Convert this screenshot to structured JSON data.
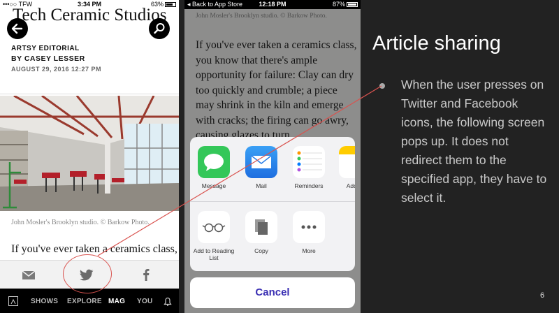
{
  "phone1": {
    "status": {
      "carrier": "•••○○ TFW",
      "time": "3:34 PM",
      "battery": "63%",
      "battery_level": 0.63
    },
    "title": "Tech Ceramic Studios",
    "editorial_label": "ARTSY EDITORIAL",
    "author": "BY CASEY LESSER",
    "date": "AUGUST 29, 2016 12:27 PM",
    "photo_caption": "John Mosler's Brooklyn studio. © Barkow Photo.",
    "body_start": "If you've ever taken a ceramics class,",
    "tabbar": {
      "shows": "SHOWS",
      "explore": "EXPLORE",
      "mag": "MAG",
      "you": "YOU"
    }
  },
  "phone2": {
    "status": {
      "back": "◂ Back to App Store",
      "time": "12:18 PM",
      "battery": "87%",
      "battery_level": 0.87
    },
    "caption": "John Mosler's Brooklyn studio. © Barkow Photo.",
    "body": "If you've ever taken a ceramics class, you know that there's ample opportunity for failure: Clay can dry too quickly and crumble; a piece may shrink in the kiln and emerge with cracks; the firing can go awry, causing glazes to turn",
    "share_apps": {
      "message": "Message",
      "mail": "Mail",
      "reminders": "Reminders",
      "addto": "Add to"
    },
    "share_actions": {
      "readinglist": "Add to Reading List",
      "copy": "Copy",
      "more": "More"
    },
    "cancel": "Cancel"
  },
  "slide": {
    "title": "Article sharing",
    "bullet": "When the user presses on Twitter and Facebook icons, the following screen pops up. It does not redirect them to the specified app, they have to select it.",
    "page_number": "6"
  },
  "colors": {
    "annotation": "#d9534f",
    "twitter": "#6b6b6b",
    "message_green": "#34c759",
    "mail_blue": "#1e88e5",
    "cancel_text": "#3a2fb3"
  }
}
